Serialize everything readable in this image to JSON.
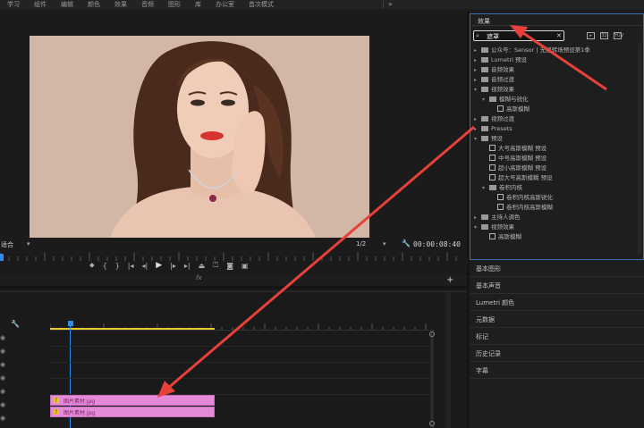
{
  "menu": {
    "items": [
      "学习",
      "组件",
      "编辑",
      "颜色",
      "效果",
      "音频",
      "图形",
      "库",
      "办公室",
      "首次模式"
    ],
    "more": "»"
  },
  "monitor": {
    "fit_label": "适合",
    "resolution": "1/2",
    "timecode": "00:00:08:40",
    "fx": "fx"
  },
  "effects_panel": {
    "title": "效果",
    "search_value": "遮罩",
    "search_icon": "magnifier-icon",
    "tree": [
      {
        "label": "公众号：Sensor | 无缝转场预设第1季",
        "level": 0,
        "kind": "folder",
        "open": false
      },
      {
        "label": "Lumetri 预设",
        "level": 0,
        "kind": "folder",
        "open": false
      },
      {
        "label": "音频效果",
        "level": 0,
        "kind": "folder",
        "open": false
      },
      {
        "label": "音频过渡",
        "level": 0,
        "kind": "folder",
        "open": false
      },
      {
        "label": "视频效果",
        "level": 0,
        "kind": "folder",
        "open": true
      },
      {
        "label": "模糊与锐化",
        "level": 1,
        "kind": "folder",
        "open": true
      },
      {
        "label": "高斯模糊",
        "level": 2,
        "kind": "preset"
      },
      {
        "label": "视频过渡",
        "level": 0,
        "kind": "folder",
        "open": false
      },
      {
        "label": "Presets",
        "level": 0,
        "kind": "folder",
        "open": false
      },
      {
        "label": "预设",
        "level": 0,
        "kind": "folder",
        "open": true
      },
      {
        "label": "大号高斯模糊 预设",
        "level": 1,
        "kind": "preset"
      },
      {
        "label": "中号高斯模糊 预设",
        "level": 1,
        "kind": "preset"
      },
      {
        "label": "超小高斯模糊 预设",
        "level": 1,
        "kind": "preset"
      },
      {
        "label": "超大号高斯模糊 预设",
        "level": 1,
        "kind": "preset"
      },
      {
        "label": "卷积内核",
        "level": 1,
        "kind": "folder",
        "open": true
      },
      {
        "label": "卷积内核高斯锐化",
        "level": 2,
        "kind": "preset"
      },
      {
        "label": "卷积内核高斯模糊",
        "level": 2,
        "kind": "preset"
      },
      {
        "label": "主持人调色",
        "level": 0,
        "kind": "folder",
        "open": false
      },
      {
        "label": "视频效果",
        "level": 0,
        "kind": "folder",
        "open": true
      },
      {
        "label": "高斯模糊",
        "level": 1,
        "kind": "preset"
      }
    ]
  },
  "panels": [
    "基本图形",
    "基本声音",
    "Lumetri 颜色",
    "元数据",
    "标记",
    "历史记录",
    "字幕"
  ],
  "timeline": {
    "clips": [
      {
        "name": "图片素材.jpg"
      },
      {
        "name": "图片素材.jpg"
      }
    ]
  },
  "colors": {
    "accent_blue": "#2d8ceb",
    "clip_pink": "#e48ad9",
    "arrow_red": "#e8403a",
    "work_area_yellow": "#e4cb2b"
  }
}
